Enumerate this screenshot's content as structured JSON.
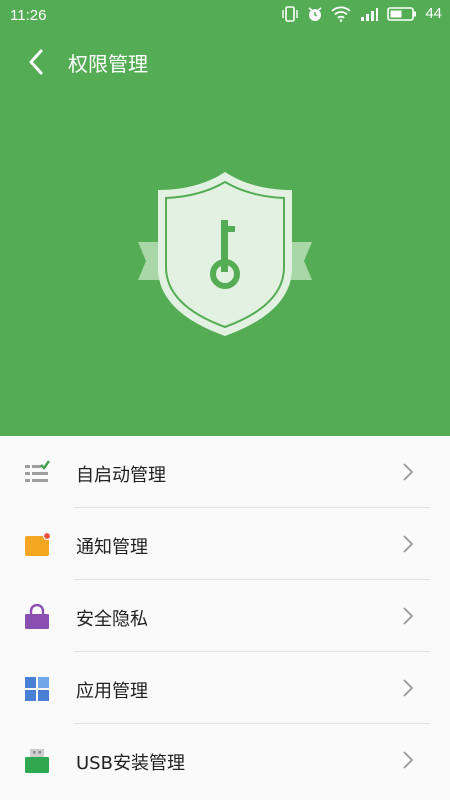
{
  "status_bar": {
    "time": "11:26",
    "battery": "44"
  },
  "header": {
    "title": "权限管理"
  },
  "menu": {
    "items": [
      {
        "label": "自启动管理",
        "icon": "autostart-icon",
        "color": "#9e9e9e"
      },
      {
        "label": "通知管理",
        "icon": "notification-icon",
        "color": "#f5a623"
      },
      {
        "label": "安全隐私",
        "icon": "privacy-lock-icon",
        "color": "#8a4fb0"
      },
      {
        "label": "应用管理",
        "icon": "app-grid-icon",
        "color": "#4a7fd6"
      },
      {
        "label": "USB安装管理",
        "icon": "usb-icon",
        "color": "#2fa84f"
      }
    ]
  },
  "colors": {
    "brand_green": "#54ad54",
    "shield_fill": "#e2f1e1",
    "key_green": "#54ad54"
  }
}
